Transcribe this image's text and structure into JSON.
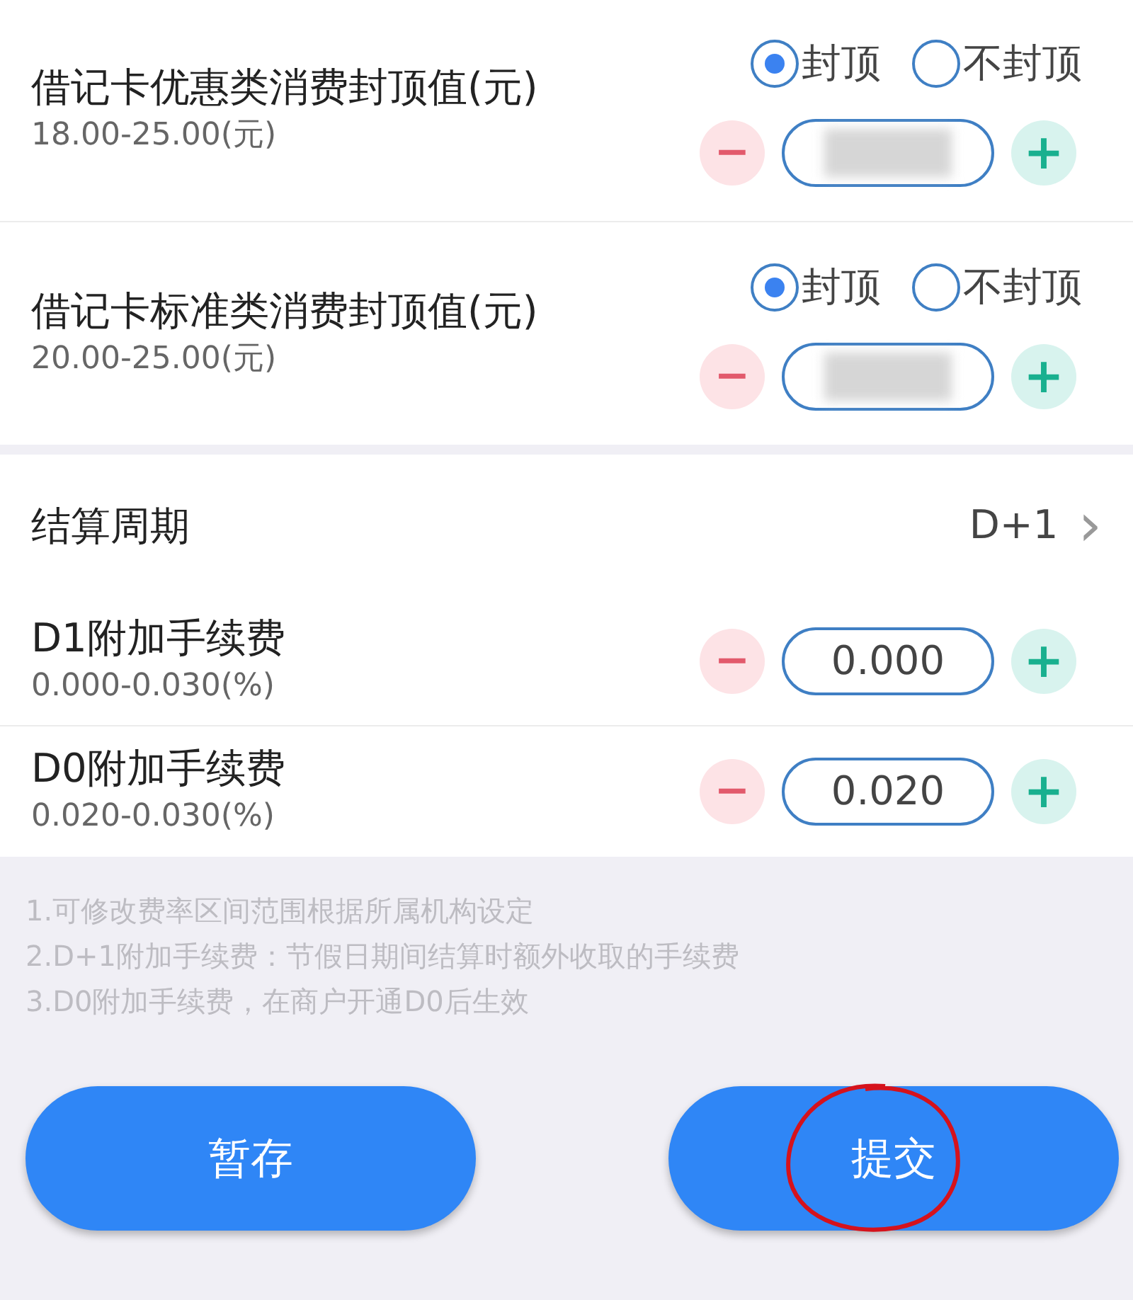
{
  "cap_items": [
    {
      "title": "借记卡优惠类消费封顶值(元)",
      "range": "18.00-25.00(元)",
      "options": [
        {
          "label": "封顶",
          "selected": true
        },
        {
          "label": "不封顶",
          "selected": false
        }
      ],
      "minus": "−",
      "plus": "+",
      "blurred": true
    },
    {
      "title": "借记卡标准类消费封顶值(元)",
      "range": "20.00-25.00(元)",
      "options": [
        {
          "label": "封顶",
          "selected": true
        },
        {
          "label": "不封顶",
          "selected": false
        }
      ],
      "minus": "−",
      "plus": "+",
      "blurred": true
    }
  ],
  "settlement": {
    "label": "结算周期",
    "value": "D+1",
    "chevron": "›"
  },
  "fee_items": [
    {
      "title": "D1附加手续费",
      "range": "0.000-0.030(%)",
      "value": "0.000",
      "minus": "−",
      "plus": "+"
    },
    {
      "title": "D0附加手续费",
      "range": "0.020-0.030(%)",
      "value": "0.020",
      "minus": "−",
      "plus": "+"
    }
  ],
  "notes": [
    "1.可修改费率区间范围根据所属机构设定",
    "2.D+1附加手续费：节假日期间结算时额外收取的手续费",
    "3.D0附加手续费，在商户开通D0后生效"
  ],
  "buttons": [
    {
      "label": "暂存",
      "circled": false
    },
    {
      "label": "提交",
      "circled": true
    }
  ]
}
